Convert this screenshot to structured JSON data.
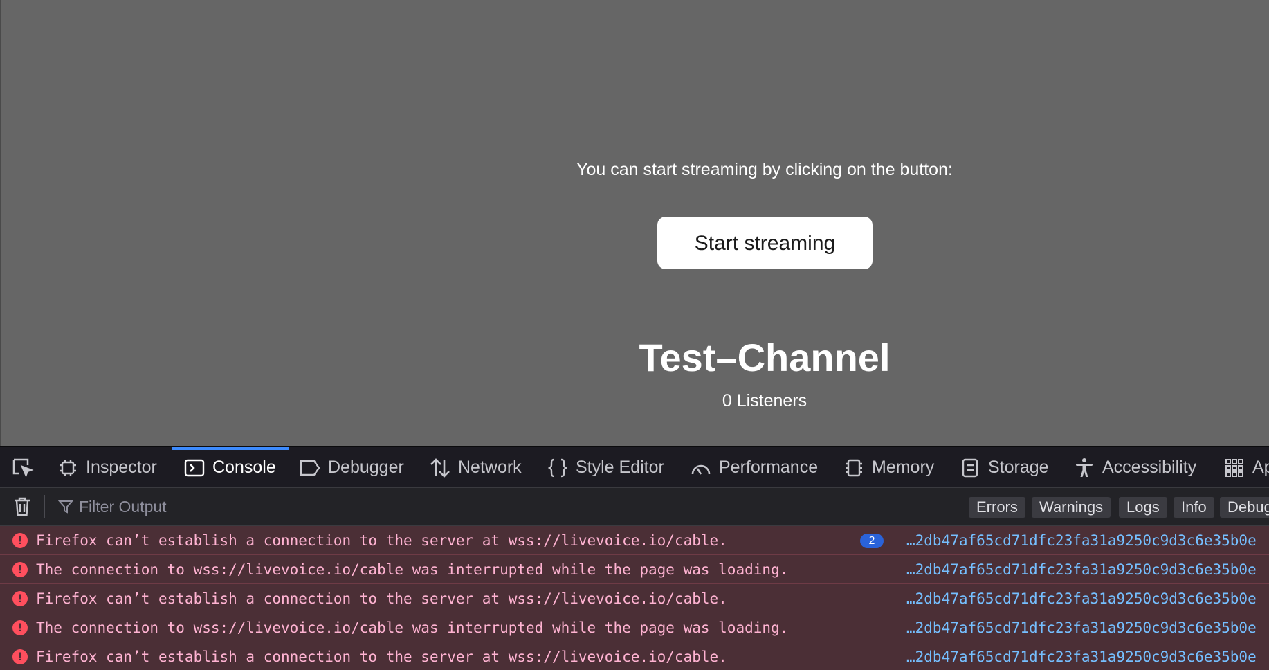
{
  "page": {
    "instruction": "You can start streaming by clicking on the button:",
    "start_button": "Start streaming",
    "channel_title": "Test–Channel",
    "listeners": "0 Listeners"
  },
  "devtools": {
    "tabs": [
      {
        "label": "Inspector",
        "icon": "inspector-icon"
      },
      {
        "label": "Console",
        "icon": "console-icon",
        "selected": true
      },
      {
        "label": "Debugger",
        "icon": "debugger-icon"
      },
      {
        "label": "Network",
        "icon": "network-icon"
      },
      {
        "label": "Style Editor",
        "icon": "style-editor-icon"
      },
      {
        "label": "Performance",
        "icon": "performance-icon"
      },
      {
        "label": "Memory",
        "icon": "memory-icon"
      },
      {
        "label": "Storage",
        "icon": "storage-icon"
      },
      {
        "label": "Accessibility",
        "icon": "accessibility-icon"
      },
      {
        "label": "Ap",
        "icon": "application-icon"
      }
    ],
    "filter_placeholder": "Filter Output",
    "levels": [
      "Errors",
      "Warnings",
      "Logs",
      "Info",
      "Debug"
    ],
    "messages": [
      {
        "text": "Firefox can’t establish a connection to the server at wss://livevoice.io/cable.",
        "count": "2",
        "source": "…2db47af65cd71dfc23fa31a9250c9d3c6e35b0e"
      },
      {
        "text": "The connection to wss://livevoice.io/cable was interrupted while the page was loading.",
        "source": "…2db47af65cd71dfc23fa31a9250c9d3c6e35b0e"
      },
      {
        "text": "Firefox can’t establish a connection to the server at wss://livevoice.io/cable.",
        "source": "…2db47af65cd71dfc23fa31a9250c9d3c6e35b0e"
      },
      {
        "text": "The connection to wss://livevoice.io/cable was interrupted while the page was loading.",
        "source": "…2db47af65cd71dfc23fa31a9250c9d3c6e35b0e"
      },
      {
        "text": "Firefox can’t establish a connection to the server at wss://livevoice.io/cable.",
        "source": "…2db47af65cd71dfc23fa31a9250c9d3c6e35b0e"
      }
    ],
    "colors": {
      "accent": "#3d8bfd",
      "error_bg": "#4b2f36",
      "error_text": "#ffb3d2",
      "link": "#75bfff"
    }
  }
}
